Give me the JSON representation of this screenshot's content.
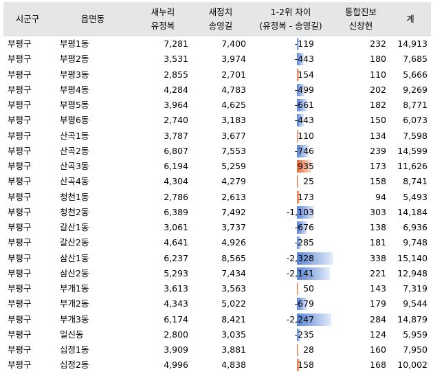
{
  "headers": [
    {
      "line1": "시군구",
      "line2": ""
    },
    {
      "line1": "읍면동",
      "line2": ""
    },
    {
      "line1": "새누리",
      "line2": "유정복"
    },
    {
      "line1": "새정치",
      "line2": "송영길"
    },
    {
      "line1": "1-2위 차이",
      "line2": "(유정복 - 송영길)"
    },
    {
      "line1": "통합진보",
      "line2": "신창현"
    },
    {
      "line1": "계",
      "line2": ""
    }
  ],
  "colors": {
    "header_bg": "#e6e6e6",
    "positive_bar": "#e8662e",
    "negative_bar": "#5b86d6"
  },
  "rows": [
    {
      "gu": "부평구",
      "dong": "부평1동",
      "yoo": "7,281",
      "song": "7,400",
      "diff": "-119",
      "diff_value": -119,
      "shin": "232",
      "total": "14,913"
    },
    {
      "gu": "부평구",
      "dong": "부평2동",
      "yoo": "3,531",
      "song": "3,974",
      "diff": "-443",
      "diff_value": -443,
      "shin": "180",
      "total": "7,685"
    },
    {
      "gu": "부평구",
      "dong": "부평3동",
      "yoo": "2,855",
      "song": "2,701",
      "diff": "154",
      "diff_value": 154,
      "shin": "110",
      "total": "5,666"
    },
    {
      "gu": "부평구",
      "dong": "부평4동",
      "yoo": "4,284",
      "song": "4,783",
      "diff": "-499",
      "diff_value": -499,
      "shin": "202",
      "total": "9,269"
    },
    {
      "gu": "부평구",
      "dong": "부평5동",
      "yoo": "3,964",
      "song": "4,625",
      "diff": "-661",
      "diff_value": -661,
      "shin": "182",
      "total": "8,771"
    },
    {
      "gu": "부평구",
      "dong": "부평6동",
      "yoo": "2,740",
      "song": "3,183",
      "diff": "-443",
      "diff_value": -443,
      "shin": "150",
      "total": "6,073"
    },
    {
      "gu": "부평구",
      "dong": "산곡1동",
      "yoo": "3,787",
      "song": "3,677",
      "diff": "110",
      "diff_value": 110,
      "shin": "134",
      "total": "7,598"
    },
    {
      "gu": "부평구",
      "dong": "산곡2동",
      "yoo": "6,807",
      "song": "7,553",
      "diff": "-746",
      "diff_value": -746,
      "shin": "239",
      "total": "14,599"
    },
    {
      "gu": "부평구",
      "dong": "산곡3동",
      "yoo": "6,194",
      "song": "5,259",
      "diff": "935",
      "diff_value": 935,
      "shin": "173",
      "total": "11,626"
    },
    {
      "gu": "부평구",
      "dong": "산곡4동",
      "yoo": "4,304",
      "song": "4,279",
      "diff": "25",
      "diff_value": 25,
      "shin": "158",
      "total": "8,741"
    },
    {
      "gu": "부평구",
      "dong": "청천1동",
      "yoo": "2,786",
      "song": "2,613",
      "diff": "173",
      "diff_value": 173,
      "shin": "94",
      "total": "5,493"
    },
    {
      "gu": "부평구",
      "dong": "청천2동",
      "yoo": "6,389",
      "song": "7,492",
      "diff": "-1,103",
      "diff_value": -1103,
      "shin": "303",
      "total": "14,184"
    },
    {
      "gu": "부평구",
      "dong": "갈산1동",
      "yoo": "3,061",
      "song": "3,737",
      "diff": "-676",
      "diff_value": -676,
      "shin": "138",
      "total": "6,936"
    },
    {
      "gu": "부평구",
      "dong": "갈산2동",
      "yoo": "4,641",
      "song": "4,926",
      "diff": "-285",
      "diff_value": -285,
      "shin": "181",
      "total": "9,748"
    },
    {
      "gu": "부평구",
      "dong": "삼산1동",
      "yoo": "6,237",
      "song": "8,565",
      "diff": "-2,328",
      "diff_value": -2328,
      "shin": "338",
      "total": "15,140"
    },
    {
      "gu": "부평구",
      "dong": "삼산2동",
      "yoo": "5,293",
      "song": "7,434",
      "diff": "-2,141",
      "diff_value": -2141,
      "shin": "221",
      "total": "12,948"
    },
    {
      "gu": "부평구",
      "dong": "부개1동",
      "yoo": "3,613",
      "song": "3,563",
      "diff": "50",
      "diff_value": 50,
      "shin": "143",
      "total": "7,319"
    },
    {
      "gu": "부평구",
      "dong": "부개2동",
      "yoo": "4,343",
      "song": "5,022",
      "diff": "-679",
      "diff_value": -679,
      "shin": "179",
      "total": "9,544"
    },
    {
      "gu": "부평구",
      "dong": "부개3동",
      "yoo": "6,174",
      "song": "8,421",
      "diff": "-2,247",
      "diff_value": -2247,
      "shin": "284",
      "total": "14,879"
    },
    {
      "gu": "부평구",
      "dong": "일신동",
      "yoo": "2,800",
      "song": "3,035",
      "diff": "-235",
      "diff_value": -235,
      "shin": "124",
      "total": "5,959"
    },
    {
      "gu": "부평구",
      "dong": "십정1동",
      "yoo": "3,909",
      "song": "3,881",
      "diff": "28",
      "diff_value": 28,
      "shin": "160",
      "total": "7,950"
    },
    {
      "gu": "부평구",
      "dong": "십정2동",
      "yoo": "4,996",
      "song": "4,838",
      "diff": "158",
      "diff_value": 158,
      "shin": "168",
      "total": "10,002"
    }
  ]
}
